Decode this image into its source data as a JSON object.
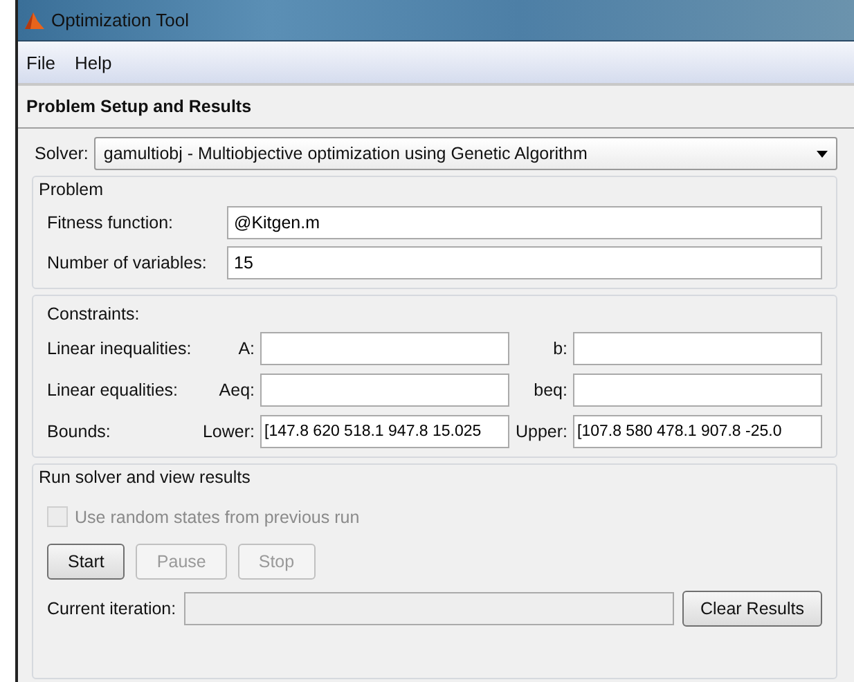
{
  "window": {
    "title": "Optimization Tool"
  },
  "menu": [
    "File",
    "Help"
  ],
  "section_title": "Problem Setup and Results",
  "solver": {
    "label": "Solver:",
    "value": "gamultiobj - Multiobjective optimization using Genetic Algorithm"
  },
  "problem": {
    "title": "Problem",
    "fields": [
      {
        "label": "Fitness function:",
        "value": "@Kitgen.m"
      },
      {
        "label": "Number of variables:",
        "value": "15"
      }
    ]
  },
  "constraints": {
    "title": "Constraints:",
    "rows": [
      {
        "label": "Linear inequalities:",
        "left_label": "A:",
        "left_value": "",
        "right_label": "b:",
        "right_value": ""
      },
      {
        "label": "Linear equalities:",
        "left_label": "Aeq:",
        "left_value": "",
        "right_label": "beq:",
        "right_value": ""
      },
      {
        "label": "Bounds:",
        "left_label": "Lower:",
        "left_value": "[147.8 620 518.1 947.8 15.025",
        "right_label": "Upper:",
        "right_value": "[107.8 580 478.1 907.8 -25.0"
      }
    ]
  },
  "run": {
    "title": "Run solver and view results",
    "checkbox": {
      "label": "Use random states from previous run",
      "checked": false,
      "disabled": true
    },
    "buttons": [
      {
        "label": "Start",
        "disabled": false
      },
      {
        "label": "Pause",
        "disabled": true
      },
      {
        "label": "Stop",
        "disabled": true
      }
    ],
    "iteration": {
      "label": "Current iteration:",
      "disabled": true
    },
    "clear_button": "Clear Results"
  }
}
